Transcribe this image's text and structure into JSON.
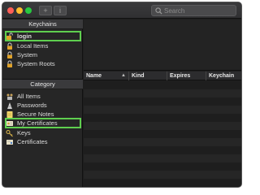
{
  "toolbar": {
    "add_label": "+",
    "info_label": "i",
    "search_placeholder": "Search"
  },
  "sidebar": {
    "keychains_header": "Keychains",
    "keychains": [
      {
        "label": "login",
        "icon": "unlock-icon"
      },
      {
        "label": "Local Items",
        "icon": "lock-icon"
      },
      {
        "label": "System",
        "icon": "lock-icon"
      },
      {
        "label": "System Roots",
        "icon": "lock-icon"
      }
    ],
    "category_header": "Category",
    "categories": [
      {
        "label": "All Items",
        "icon": "all-items-icon"
      },
      {
        "label": "Passwords",
        "icon": "passwords-icon"
      },
      {
        "label": "Secure Notes",
        "icon": "secure-notes-icon"
      },
      {
        "label": "My Certificates",
        "icon": "my-certificates-icon"
      },
      {
        "label": "Keys",
        "icon": "keys-icon"
      },
      {
        "label": "Certificates",
        "icon": "certificates-icon"
      }
    ]
  },
  "table": {
    "columns": [
      "Name",
      "Kind",
      "Expires",
      "Keychain"
    ],
    "rows": []
  },
  "colors": {
    "highlight_outline": "#5fcf4f"
  }
}
